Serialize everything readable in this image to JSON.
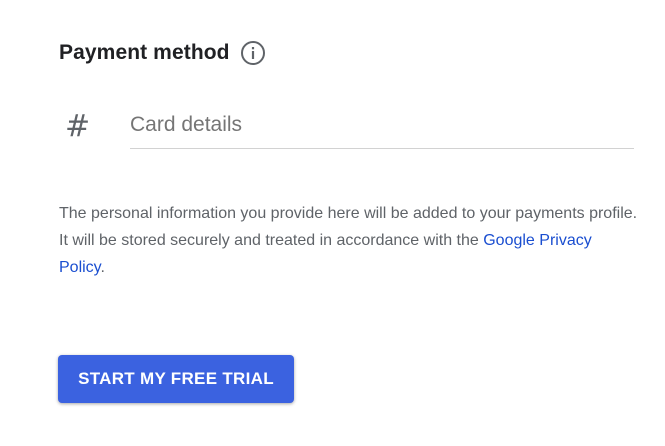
{
  "payment": {
    "title": "Payment method",
    "info_icon": "info-icon",
    "card_field": {
      "icon": "hash-icon",
      "icon_glyph": "#",
      "value": "",
      "placeholder": "Card details"
    },
    "disclaimer": {
      "text": "The personal information you provide here will be added to your payments profile. It will be stored securely and treated in accordance with the ",
      "link_text": "Google Privacy Policy",
      "suffix": "."
    },
    "cta_label": "START MY FREE TRIAL"
  },
  "colors": {
    "accent": "#3b62e0",
    "link": "#1a4ed0",
    "title_text": "#202124",
    "body_text": "#5f6368",
    "underline": "#d2d2d2"
  }
}
